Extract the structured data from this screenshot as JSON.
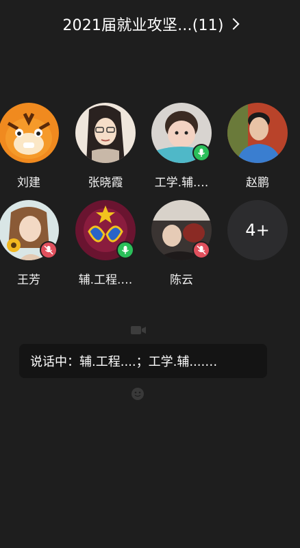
{
  "header": {
    "title": "2021届就业攻坚...(11)"
  },
  "members": [
    {
      "name": "刘建",
      "avatar": "tiger-cartoon-avatar",
      "mic": "none"
    },
    {
      "name": "张晓霞",
      "avatar": "illustrated-woman-glasses-avatar",
      "mic": "none"
    },
    {
      "name": "工学.辅.…",
      "avatar": "child-photo-avatar",
      "mic": "on"
    },
    {
      "name": "赵鹏",
      "avatar": "man-photo-avatar",
      "mic": "none"
    },
    {
      "name": "王芳",
      "avatar": "girl-sunflower-avatar",
      "mic": "off"
    },
    {
      "name": "辅.工程.…",
      "avatar": "blue-pendant-avatar",
      "mic": "on"
    },
    {
      "name": "陈云",
      "avatar": "crowd-photo-avatar",
      "mic": "off"
    }
  ],
  "more": {
    "label": "4+"
  },
  "speaking": {
    "text": "说话中：辅.工程....；工学.辅....…"
  },
  "colors": {
    "background": "#1e1e1e",
    "mic_on": "#2bbf5a",
    "mic_off": "#e0505d"
  }
}
